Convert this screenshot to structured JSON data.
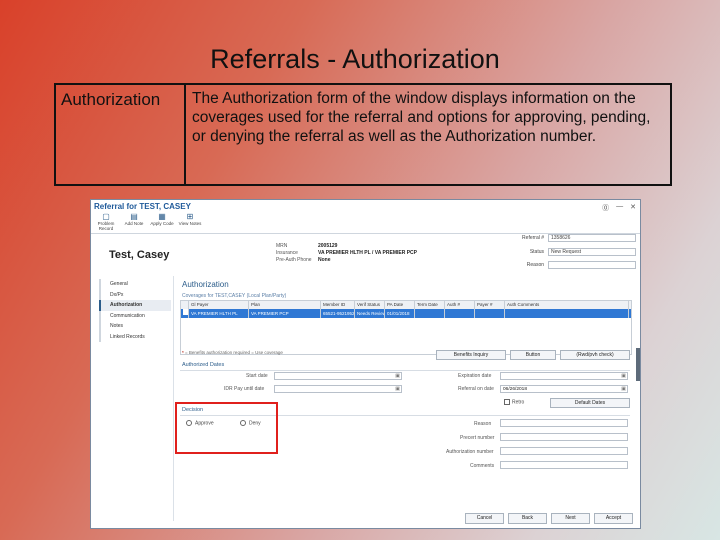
{
  "slide": {
    "title": "Referrals - Authorization",
    "label": "Authorization",
    "description": "The Authorization form of the window displays information on the coverages used for the referral and options for approving, pending, or denying the referral as well as the Authorization number."
  },
  "window": {
    "title": "Referral for TEST, CASEY",
    "toolbar": [
      "Problem Record",
      "Add Note",
      "Apply Code",
      "View Notes"
    ],
    "patient_name": "Test, Casey",
    "info": [
      {
        "label": "MRN",
        "value": "2005129"
      },
      {
        "label": "Insurance",
        "value": "VA PREMIER HLTH PL / VA PREMIER PCP"
      },
      {
        "label": "Pre-Auth Phone",
        "value": "None"
      }
    ],
    "referral_number_label": "Referral #",
    "referral_number": "1358626",
    "status_label": "Status",
    "status": "New Request",
    "reason_label": "Reason",
    "sidebar": [
      "General",
      "Dx/Px",
      "Authorization",
      "Communication",
      "Notes",
      "Linked Records"
    ],
    "panel": {
      "title": "Authorization",
      "coverage_label": "Coverages for TEST,CASEY (Local Plan/Party)",
      "columns": [
        "",
        "Gl Payer",
        "Plan",
        "Member ID",
        "Verif Status",
        "PA Date",
        "Term Date",
        "Auth #",
        "Payer #",
        "Auth Comments"
      ],
      "row": [
        "",
        "VA PREMIER HLTH PL",
        "VA PREMIER PCP",
        "65521-9521952",
        "Needs Review",
        "01/01/2018",
        "",
        "",
        "",
        ""
      ],
      "legend": "= Benefits authorization required   = Use coverage",
      "btn_benefits": "Benefits Inquiry",
      "btn_button": "Button",
      "btn_rwd": "(Rwd/pvh check)",
      "dates_title": "Authorized Dates",
      "start_date": "Start date",
      "idr_label": "IDR Pay until date",
      "expiration_date": "Expiration date",
      "referral_on_date": "Referral on date",
      "referral_on_date_value": "06/26/2018",
      "retro": "Retro",
      "default_dates": "Default Dates",
      "decision_title": "Decision",
      "approve": "Approve",
      "deny": "Deny",
      "reason": "Reason",
      "precert_number": "Precert number",
      "auth_number": "Authorization number",
      "comments": "Comments"
    },
    "footer": [
      "Cancel",
      "Back",
      "Next",
      "Accept"
    ]
  }
}
